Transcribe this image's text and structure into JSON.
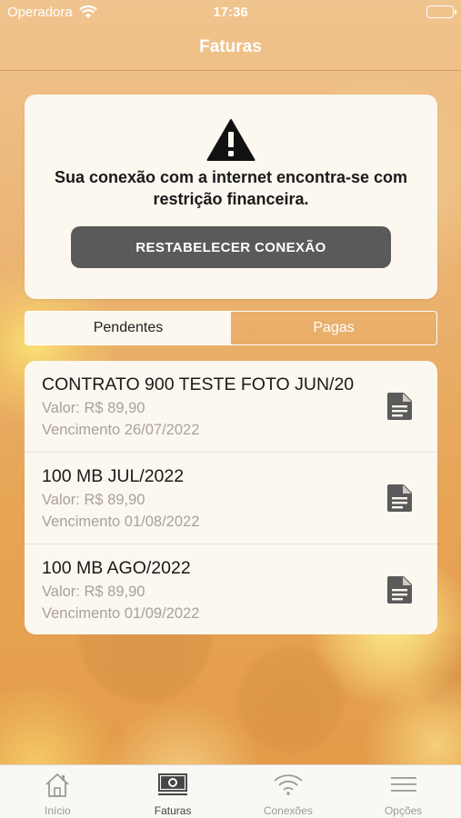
{
  "status_bar": {
    "carrier": "Operadora",
    "time": "17:36"
  },
  "header": {
    "title": "Faturas"
  },
  "alert": {
    "message": "Sua conexão com a internet encontra-se com restrição financeira.",
    "button_label": "RESTABELECER CONEXÃO",
    "icon": "warning-icon"
  },
  "segments": {
    "pending": "Pendentes",
    "paid": "Pagas",
    "selected": "Pendentes"
  },
  "invoices": [
    {
      "title": "CONTRATO 900 TESTE FOTO JUN/20",
      "value": "Valor: R$ 89,90",
      "due": "Vencimento 26/07/2022",
      "icon": "document-icon"
    },
    {
      "title": "100 MB JUL/2022",
      "value": "Valor: R$ 89,90",
      "due": "Vencimento 01/08/2022",
      "icon": "document-icon"
    },
    {
      "title": "100 MB AGO/2022",
      "value": "Valor: R$ 89,90",
      "due": "Vencimento 01/09/2022",
      "icon": "document-icon"
    }
  ],
  "tabbar": {
    "tabs": [
      {
        "label": "Início",
        "icon": "home-icon"
      },
      {
        "label": "Faturas",
        "icon": "invoice-icon"
      },
      {
        "label": "Conexões",
        "icon": "wifi-icon"
      },
      {
        "label": "Opções",
        "icon": "menu-icon"
      }
    ],
    "active": "Faturas"
  },
  "colors": {
    "card_background": "#fcf7ef",
    "button_background": "#5a5a5a",
    "secondary_text": "#a8a29a"
  }
}
